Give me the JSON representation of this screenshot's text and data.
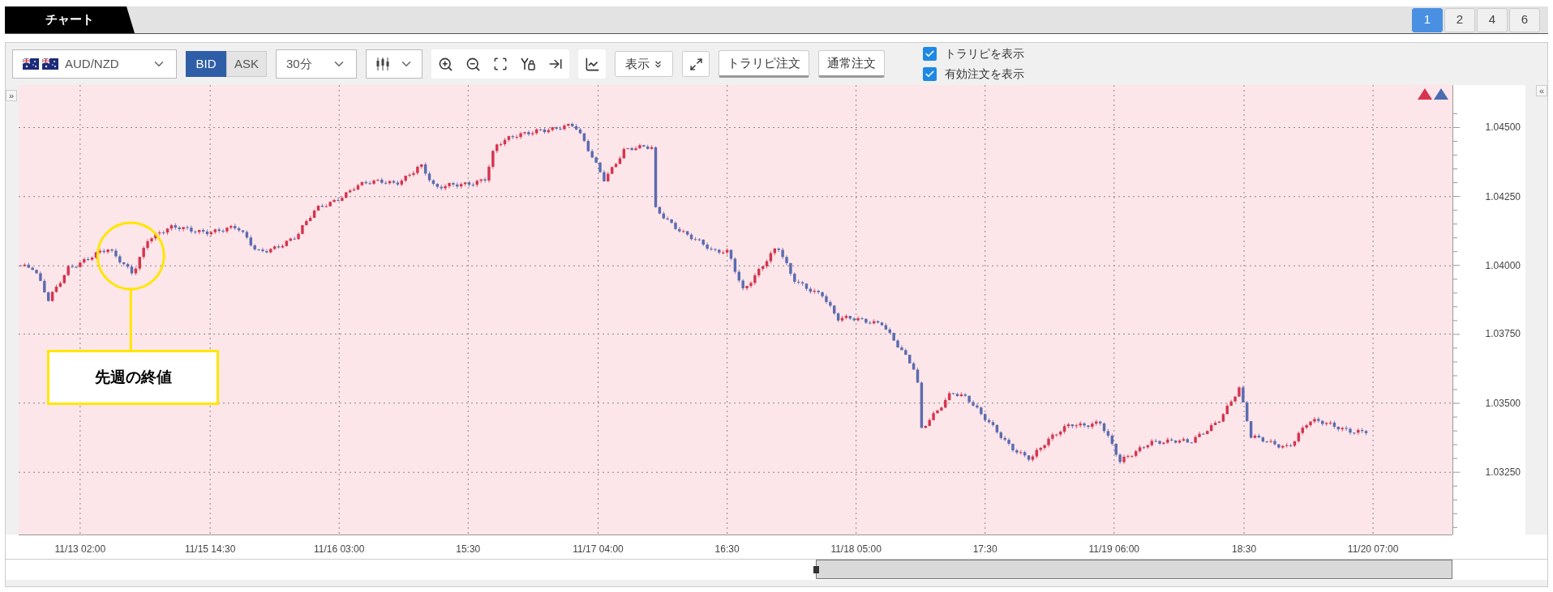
{
  "tabs": [
    {
      "label": "チャート",
      "selected": true
    }
  ],
  "layout_buttons": [
    {
      "label": "1",
      "selected": true
    },
    {
      "label": "2",
      "selected": false
    },
    {
      "label": "4",
      "selected": false
    },
    {
      "label": "6",
      "selected": false
    }
  ],
  "toolbar": {
    "pair": "AUD/NZD",
    "price_types": [
      {
        "label": "BID",
        "selected": true
      },
      {
        "label": "ASK",
        "selected": false
      }
    ],
    "timeframe": "30分",
    "view_button": "表示",
    "order_buttons": [
      "トラリピ注文",
      "通常注文"
    ],
    "checkboxes": [
      {
        "label": "トラリピを表示",
        "checked": true
      },
      {
        "label": "有効注文を表示",
        "checked": true
      }
    ]
  },
  "chart": {
    "y_axis_labels": [
      "1.04500",
      "1.04250",
      "1.04000",
      "1.03750",
      "1.03500",
      "1.03250"
    ],
    "x_axis_labels": [
      "11/13 02:00",
      "11/15 14:30",
      "11/16 03:00",
      "15:30",
      "11/17 04:00",
      "16:30",
      "11/18 05:00",
      "17:30",
      "11/19 06:00",
      "18:30",
      "11/20 07:00"
    ],
    "annotation": "先週の終値",
    "expand_left": "»",
    "expand_right": "«"
  }
}
